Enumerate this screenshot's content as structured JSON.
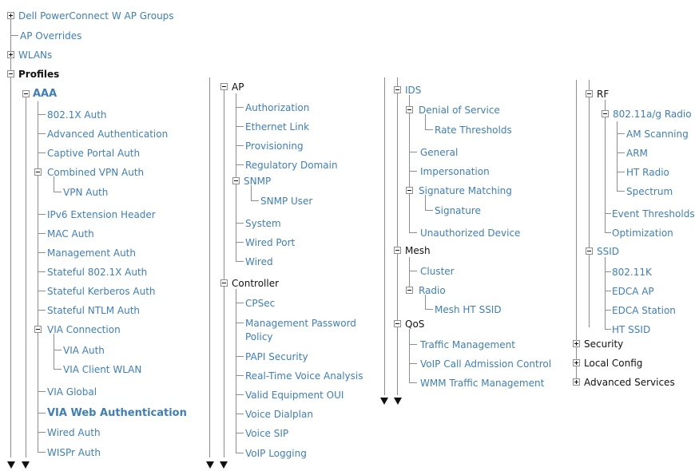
{
  "tree": {
    "col1": {
      "dell_groups": "Dell PowerConnect W AP Groups",
      "ap_overrides": "AP Overrides",
      "wlans": "WLANs",
      "profiles": "Profiles",
      "aaa": "AAA",
      "aaa_items": {
        "dot1x_auth": "802.1X Auth",
        "advanced_auth": "Advanced Authentication",
        "captive_portal_auth": "Captive Portal Auth",
        "combined_vpn_auth": "Combined VPN Auth",
        "vpn_auth": "VPN Auth",
        "ipv6_ext_header": "IPv6 Extension Header",
        "mac_auth": "MAC Auth",
        "management_auth": "Management Auth",
        "stateful_8021x_auth": "Stateful 802.1X Auth",
        "stateful_kerberos_auth": "Stateful Kerberos Auth",
        "stateful_ntlm_auth": "Stateful NTLM Auth",
        "via_connection": "VIA Connection",
        "via_auth": "VIA Auth",
        "via_client_wlan": "VIA Client WLAN",
        "via_global": "VIA Global",
        "via_web_auth": "VIA Web Authentication",
        "wired_auth": "Wired Auth",
        "wispr_auth": "WISPr Auth"
      }
    },
    "col2": {
      "ap": "AP",
      "ap_items": {
        "authorization": "Authorization",
        "ethernet_link": "Ethernet Link",
        "provisioning": "Provisioning",
        "regulatory_domain": "Regulatory Domain",
        "snmp": "SNMP",
        "snmp_user": "SNMP User",
        "system": "System",
        "wired_port": "Wired Port",
        "wired": "Wired"
      },
      "controller": "Controller",
      "controller_items": {
        "cpsec": "CPSec",
        "mgmt_password_policy_1": "Management Password",
        "mgmt_password_policy_2": "Policy",
        "papi_security": "PAPI Security",
        "realtime_voice": "Real-Time Voice Analysis",
        "valid_equipment_oui": "Valid Equipment OUI",
        "voice_dialplan": "Voice Dialplan",
        "voice_sip": "Voice SIP",
        "voip_logging": "VoIP Logging"
      }
    },
    "col3": {
      "ids": "IDS",
      "ids_items": {
        "denial_of_service": "Denial of Service",
        "rate_thresholds": "Rate Thresholds",
        "general": "General",
        "impersonation": "Impersonation",
        "signature_matching": "Signature Matching",
        "signature": "Signature",
        "unauthorized_device": "Unauthorized Device"
      },
      "mesh": "Mesh",
      "mesh_items": {
        "cluster": "Cluster",
        "radio": "Radio",
        "mesh_ht_ssid": "Mesh HT SSID"
      },
      "qos": "QoS",
      "qos_items": {
        "traffic_management": "Traffic Management",
        "voip_cac": "VoIP Call Admission Control",
        "wmm_traffic_management": "WMM Traffic Management"
      }
    },
    "col4": {
      "rf": "RF",
      "rf_items": {
        "radio_80211ag": "802.11a/g Radio",
        "am_scanning": "AM Scanning",
        "arm": "ARM",
        "ht_radio": "HT Radio",
        "spectrum": "Spectrum",
        "event_thresholds": "Event Thresholds",
        "optimization": "Optimization"
      },
      "ssid": "SSID",
      "ssid_items": {
        "dot11k": "802.11K",
        "edca_ap": "EDCA AP",
        "edca_station": "EDCA Station",
        "ht_ssid": "HT SSID"
      },
      "security": "Security",
      "local_config": "Local Config",
      "advanced_services": "Advanced Services"
    }
  },
  "colors": {
    "link": "#3f7fb5",
    "text": "#111111",
    "tree_line": "#8d8d8d"
  }
}
